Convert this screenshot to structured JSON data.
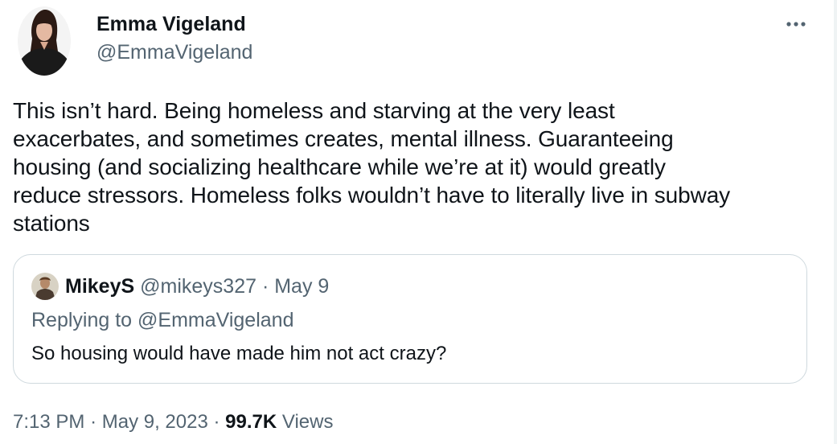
{
  "tweet": {
    "author": {
      "display_name": "Emma Vigeland",
      "handle": "@EmmaVigeland",
      "avatar_icon": "profile-photo"
    },
    "more_icon": "more-options-icon",
    "text": "This isn’t hard. Being homeless and starving at the very least\nexacerbates, and sometimes creates, mental illness. Guaranteeing\nhousing (and socializing healthcare while we’re at it) would greatly\nreduce stressors. Homeless folks wouldn’t have to literally live in subway\nstations",
    "quote": {
      "author_name": "MikeyS",
      "author_handle": "@mikeys327",
      "separator": "·",
      "date": "May 9",
      "replying_to": "Replying to @EmmaVigeland",
      "text": "So housing would have made him not act crazy?"
    },
    "meta": {
      "time": "7:13 PM",
      "separator": "·",
      "date": "May 9, 2023",
      "views_count": "99.7K",
      "views_label": "Views"
    }
  },
  "colors": {
    "primary_text": "#0f1419",
    "secondary_text": "#536471",
    "border": "#cfd9de"
  }
}
